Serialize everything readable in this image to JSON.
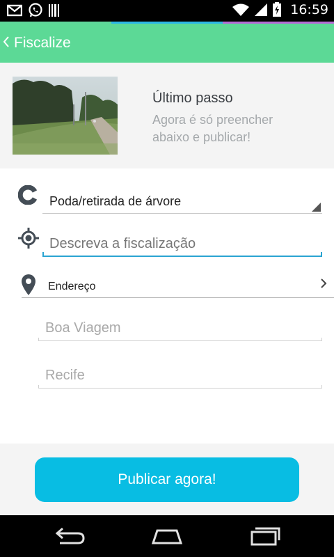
{
  "status_bar": {
    "time": "16:59",
    "icons": [
      "gmail-icon",
      "whatsapp-icon",
      "barcode-icon",
      "wifi-icon",
      "signal-icon",
      "battery-icon"
    ]
  },
  "app_bar": {
    "title": "Fiscalize",
    "color": "#5cd996"
  },
  "header": {
    "photo": "street-photo",
    "title": "Último passo",
    "subtitle": "Agora é só preencher abaixo e publicar!"
  },
  "form": {
    "category": {
      "value": "Poda/retirada de árvore",
      "icon": "category-c-icon"
    },
    "description": {
      "value": "",
      "placeholder": "Descreva a fiscalização",
      "icon": "target-icon"
    },
    "address": {
      "label": "Endereço",
      "icon": "location-pin-icon"
    },
    "neighborhood": {
      "value": "",
      "placeholder": "Boa Viagem"
    },
    "city": {
      "value": "",
      "placeholder": "Recife"
    }
  },
  "footer": {
    "publish_label": "Publicar agora!",
    "accent": "#08bde3"
  },
  "nav_bar": {
    "buttons": [
      "back-icon",
      "home-icon",
      "recent-apps-icon"
    ]
  }
}
